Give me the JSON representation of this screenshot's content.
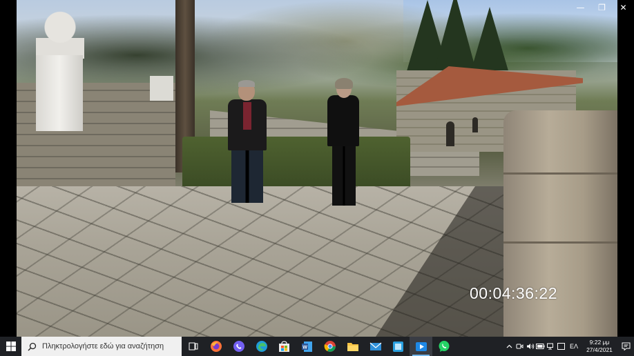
{
  "window": {
    "controls": [
      {
        "name": "minimize",
        "glyph": "—"
      },
      {
        "name": "restore",
        "glyph": "❐"
      },
      {
        "name": "close",
        "glyph": "✕"
      }
    ]
  },
  "video": {
    "timecode": "00:04:36:22"
  },
  "taskbar": {
    "start_icon": "windows-logo-icon",
    "search_placeholder": "Πληκτρολογήστε εδώ για αναζήτηση",
    "apps": [
      {
        "name": "task-view",
        "icon": "task-view-icon",
        "color": "#ffffff"
      },
      {
        "name": "firefox",
        "icon": "firefox-icon",
        "color": "#ff7139"
      },
      {
        "name": "viber",
        "icon": "viber-icon",
        "color": "#7360f2"
      },
      {
        "name": "edge",
        "icon": "edge-icon",
        "color": "#1f9bd8"
      },
      {
        "name": "store",
        "icon": "store-icon",
        "color": "#f3c33f"
      },
      {
        "name": "word",
        "icon": "word-icon",
        "color": "#2b579a"
      },
      {
        "name": "chrome",
        "icon": "chrome-icon",
        "color": "#db4437"
      },
      {
        "name": "file-explorer",
        "icon": "folder-icon",
        "color": "#f6c244"
      },
      {
        "name": "mail",
        "icon": "mail-icon",
        "color": "#2f8fd8"
      },
      {
        "name": "app-blue",
        "icon": "app-icon",
        "color": "#2aa0df"
      },
      {
        "name": "media-player",
        "icon": "media-player-icon",
        "color": "#1e88e5",
        "active": true
      },
      {
        "name": "whatsapp",
        "icon": "whatsapp-icon",
        "color": "#25d366"
      }
    ],
    "tray": {
      "icons": [
        "chevron-up-icon",
        "meet-now-icon",
        "volume-icon",
        "battery-icon",
        "network-icon",
        "ime-icon"
      ],
      "language": "ΕΛ",
      "time": "9:22 μμ",
      "date": "27/4/2021",
      "notification_icon": "notification-icon"
    }
  }
}
